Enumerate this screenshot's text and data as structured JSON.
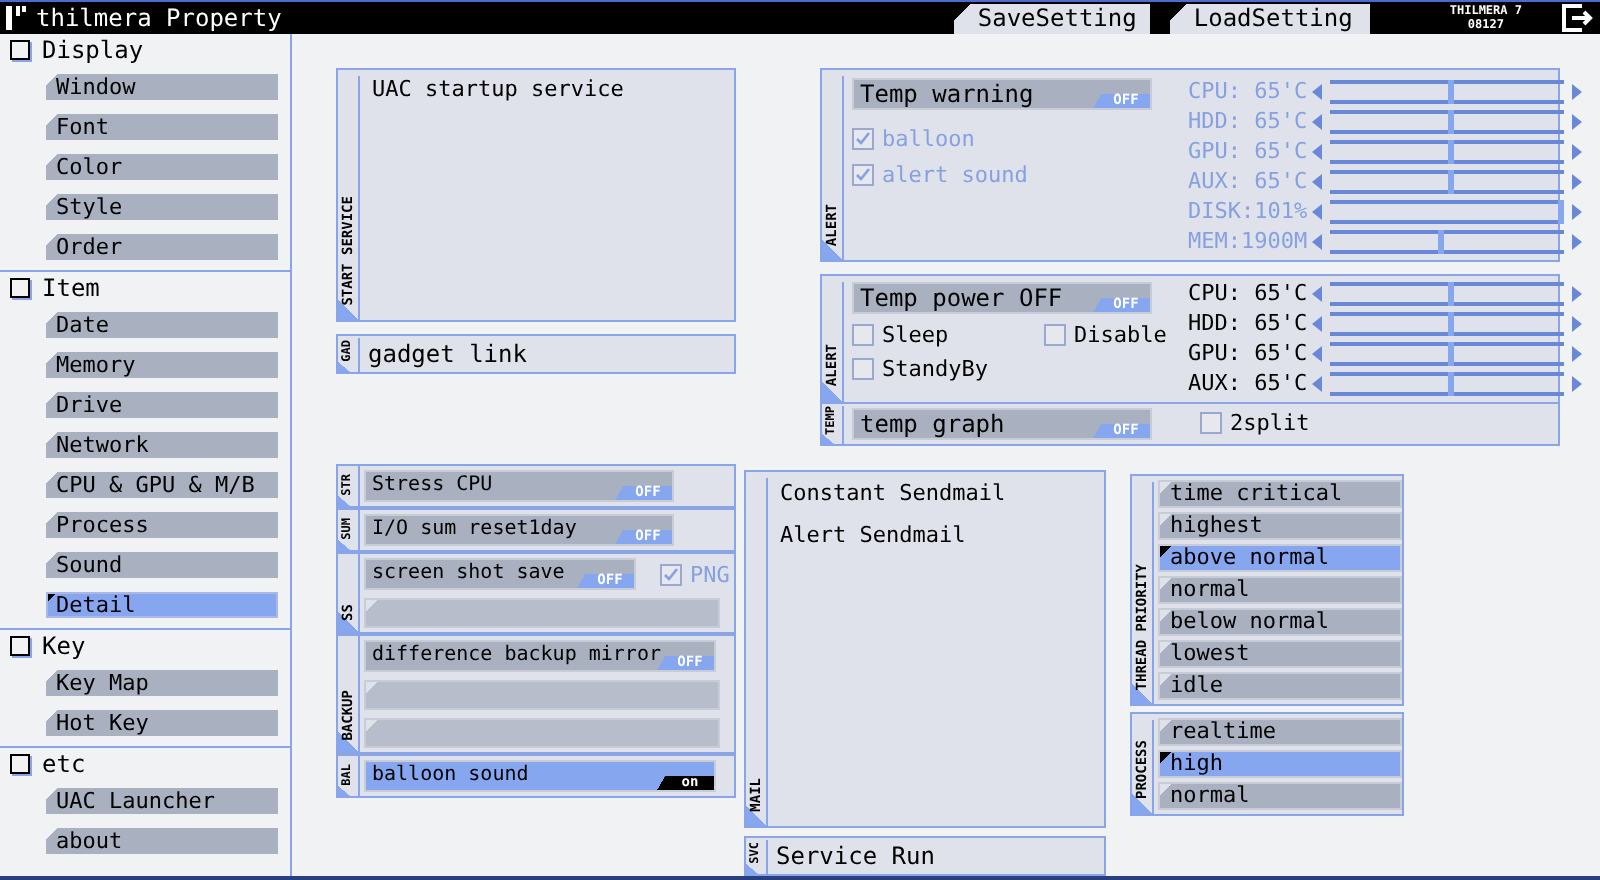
{
  "window": {
    "title": "thilmera Property"
  },
  "toolbar": {
    "buttons": [
      {
        "label": "SaveSetting"
      },
      {
        "label": "LoadSetting"
      }
    ],
    "badge": [
      "THILMERA 7",
      "08127"
    ]
  },
  "sidebar": {
    "sections": [
      {
        "label": "Display",
        "items": [
          {
            "label": "Window",
            "selected": false
          },
          {
            "label": "Font",
            "selected": false
          },
          {
            "label": "Color",
            "selected": false
          },
          {
            "label": "Style",
            "selected": false
          },
          {
            "label": "Order",
            "selected": false
          }
        ]
      },
      {
        "label": "Item",
        "items": [
          {
            "label": "Date",
            "selected": false
          },
          {
            "label": "Memory",
            "selected": false
          },
          {
            "label": "Drive",
            "selected": false
          },
          {
            "label": "Network",
            "selected": false
          },
          {
            "label": "CPU & GPU & M/B",
            "selected": false
          },
          {
            "label": "Process",
            "selected": false
          },
          {
            "label": "Sound",
            "selected": false
          },
          {
            "label": "Detail",
            "selected": true
          }
        ]
      },
      {
        "label": "Key",
        "items": [
          {
            "label": "Key Map",
            "selected": false
          },
          {
            "label": "Hot Key",
            "selected": false
          }
        ]
      },
      {
        "label": "etc",
        "items": [
          {
            "label": "UAC Launcher",
            "selected": false
          },
          {
            "label": "about",
            "selected": false
          }
        ]
      }
    ]
  },
  "startup": {
    "side_label": "START SERVICE",
    "text": "UAC startup service"
  },
  "gadget": {
    "side_label": "GAD",
    "text": "gadget link"
  },
  "alert": {
    "side_label": "ALERT",
    "disabled": true,
    "toggle": {
      "label": "Temp warning",
      "state": "OFF",
      "on": false
    },
    "options": [
      {
        "label": "balloon",
        "checked": true
      },
      {
        "label": "alert sound",
        "checked": true
      }
    ],
    "sliders": [
      {
        "label": "CPU: 65'C",
        "level": 0.52
      },
      {
        "label": "HDD: 65'C",
        "level": 0.52
      },
      {
        "label": "GPU: 65'C",
        "level": 0.52
      },
      {
        "label": "AUX: 65'C",
        "level": 0.52
      },
      {
        "label": "DISK:101%",
        "level": 1
      },
      {
        "label": "MEM:1900M",
        "level": 0.47
      }
    ]
  },
  "power": {
    "side_label": "ALERT",
    "disabled": false,
    "toggle": {
      "label": "Temp power OFF",
      "state": "OFF",
      "on": false
    },
    "options": [
      {
        "label": "Sleep",
        "checked": false
      },
      {
        "label": "Disable",
        "checked": false
      },
      {
        "label": "StandyBy",
        "checked": false
      }
    ],
    "sliders": [
      {
        "label": "CPU: 65'C",
        "level": 0.52
      },
      {
        "label": "HDD: 65'C",
        "level": 0.52
      },
      {
        "label": "GPU: 65'C",
        "level": 0.52
      },
      {
        "label": "AUX: 65'C",
        "level": 0.52
      }
    ]
  },
  "graph": {
    "side_label": "TEMP",
    "toggle": {
      "label": "temp graph",
      "state": "OFF",
      "on": false
    },
    "option": {
      "label": "2split",
      "checked": false
    }
  },
  "tasks": [
    {
      "kind": "toggle",
      "side_label": "STR",
      "toggle": {
        "label": "Stress CPU",
        "state": "OFF",
        "on": false
      }
    },
    {
      "kind": "toggle",
      "side_label": "SUM",
      "toggle": {
        "label": "I/O sum reset1day",
        "state": "OFF",
        "on": false
      }
    },
    {
      "kind": "capture",
      "side_label": "SS",
      "toggle": {
        "label": "screen shot save",
        "state": "OFF",
        "on": false
      },
      "option": {
        "label": "PNG",
        "checked": true,
        "disabled": true
      }
    },
    {
      "kind": "backup",
      "side_label": "BACKUP",
      "toggle": {
        "label": "difference backup mirror",
        "state": "OFF",
        "on": false
      }
    },
    {
      "kind": "toggle",
      "side_label": "BAL",
      "toggle": {
        "label": "balloon sound",
        "state": "on",
        "on": true
      }
    }
  ],
  "mail": {
    "side_label": "MAIL",
    "items": [
      "Constant Sendmail",
      "Alert Sendmail"
    ]
  },
  "service": {
    "side_label": "SVC",
    "text": "Service Run"
  },
  "thread_priority": {
    "side_label": "THREAD PRIORITY",
    "items": [
      {
        "label": "time critical",
        "selected": false
      },
      {
        "label": "highest",
        "selected": false
      },
      {
        "label": "above normal",
        "selected": true
      },
      {
        "label": "normal",
        "selected": false
      },
      {
        "label": "below normal",
        "selected": false
      },
      {
        "label": "lowest",
        "selected": false
      },
      {
        "label": "idle",
        "selected": false
      }
    ]
  },
  "process": {
    "side_label": "PROCESS",
    "items": [
      {
        "label": "realtime",
        "selected": false
      },
      {
        "label": "high",
        "selected": true
      },
      {
        "label": "normal",
        "selected": false
      }
    ]
  }
}
